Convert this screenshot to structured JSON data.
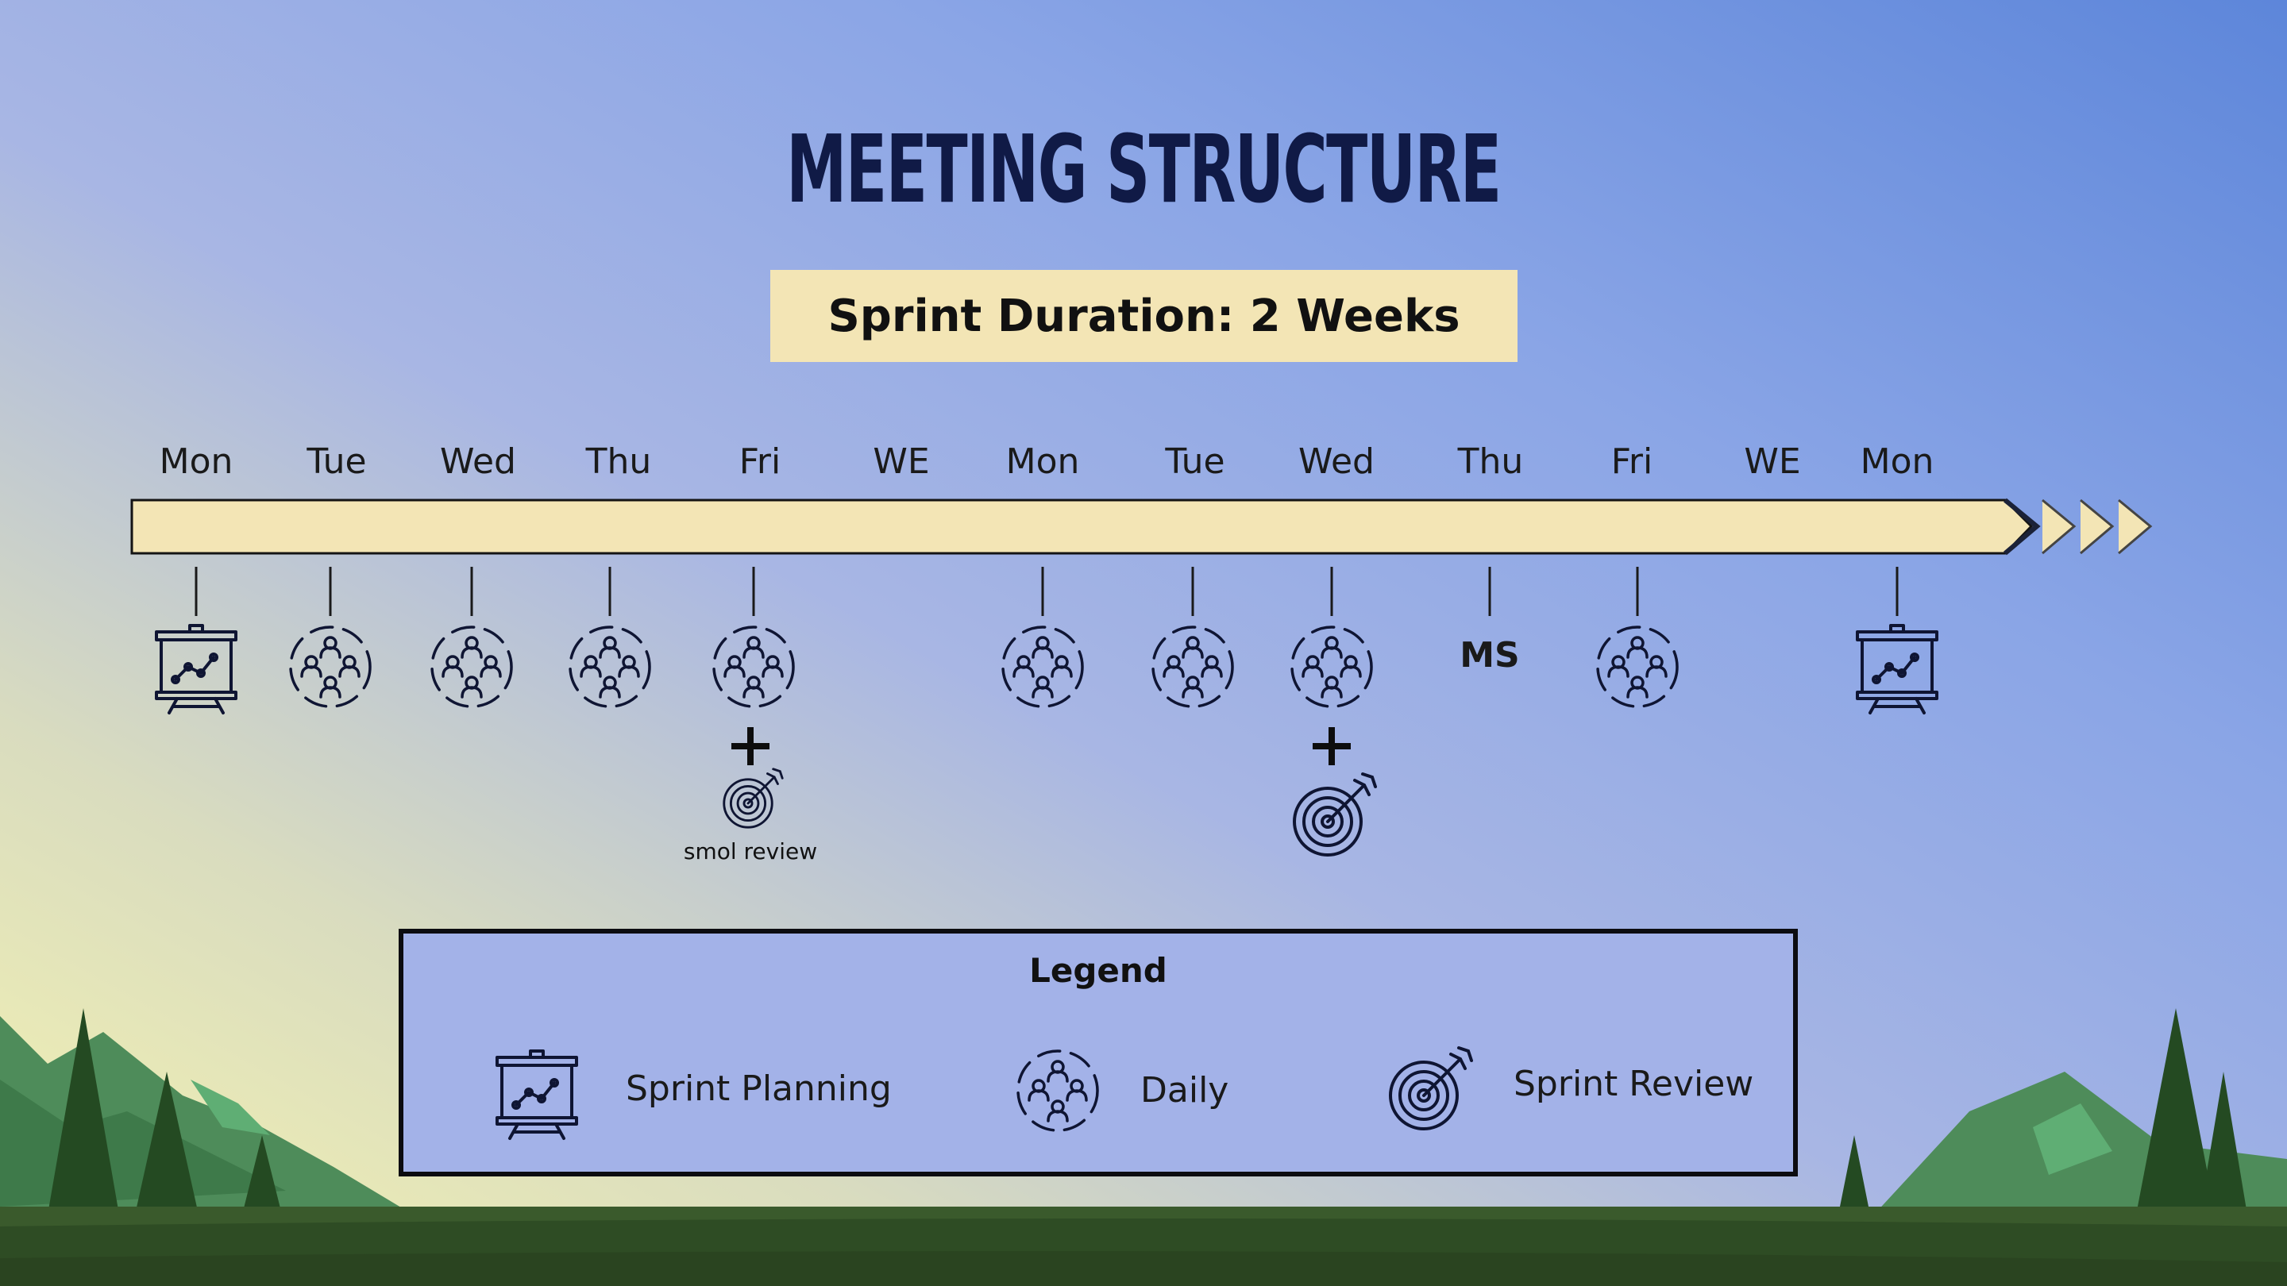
{
  "title": "MEETING STRUCTURE",
  "sprint_duration": "Sprint Duration: 2 Weeks",
  "days": [
    "Mon",
    "Tue",
    "Wed",
    "Thu",
    "Fri",
    "WE",
    "Mon",
    "Tue",
    "Wed",
    "Thu",
    "Fri",
    "WE",
    "Mon"
  ],
  "markers": [
    "planning",
    "daily",
    "daily",
    "daily",
    "daily",
    "daily",
    "daily",
    "daily",
    "ms",
    "daily",
    "planning"
  ],
  "ms_label": "MS",
  "smol_review_label": "smol review",
  "legend": {
    "title": "Legend",
    "planning": "Sprint Planning",
    "daily": "Daily",
    "review": "Sprint Review"
  },
  "colors": {
    "timeline_fill": "#f3e5b5",
    "icon_stroke": "#0f1533",
    "title": "#101a46"
  }
}
